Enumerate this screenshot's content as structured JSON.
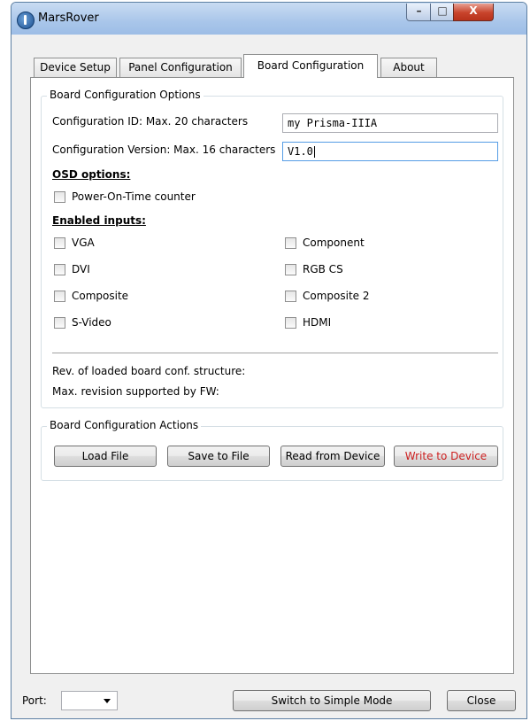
{
  "window": {
    "title": "MarsRover",
    "controls": {
      "minimize": "–",
      "maximize": "□",
      "close": "X"
    }
  },
  "tabs": [
    {
      "label": "Device Setup",
      "active": false
    },
    {
      "label": "Panel Configuration",
      "active": false
    },
    {
      "label": "Board Configuration",
      "active": true
    },
    {
      "label": "About",
      "active": false
    }
  ],
  "options_group": {
    "title": "Board Configuration Options",
    "config_id": {
      "label": "Configuration ID: Max. 20 characters",
      "value": "my Prisma-IIIA"
    },
    "config_version": {
      "label": "Configuration Version: Max. 16 characters",
      "value": "V1.0"
    },
    "osd": {
      "heading": "OSD options:",
      "power_on_time": {
        "label": "Power-On-Time counter",
        "checked": false
      }
    },
    "inputs": {
      "heading": "Enabled inputs:",
      "left": [
        {
          "label": "VGA",
          "checked": false
        },
        {
          "label": "DVI",
          "checked": false
        },
        {
          "label": "Composite",
          "checked": false
        },
        {
          "label": "S-Video",
          "checked": false
        }
      ],
      "right": [
        {
          "label": "Component",
          "checked": false
        },
        {
          "label": "RGB CS",
          "checked": false
        },
        {
          "label": "Composite 2",
          "checked": false
        },
        {
          "label": "HDMI",
          "checked": false
        }
      ]
    },
    "rev_loaded_label": "Rev. of loaded board conf. structure:",
    "max_rev_label": "Max. revision supported by FW:"
  },
  "actions_group": {
    "title": "Board Configuration Actions",
    "buttons": {
      "load": "Load File",
      "save": "Save to File",
      "read": "Read from Device",
      "write": "Write to Device"
    }
  },
  "footer": {
    "port_label": "Port:",
    "port_value": "",
    "simple_mode_button": "Switch to Simple Mode",
    "close_button": "Close"
  },
  "colors": {
    "write_button_text": "#cc1f1f",
    "titlebar": "#a9c6ea",
    "focus_border": "#569de5"
  }
}
